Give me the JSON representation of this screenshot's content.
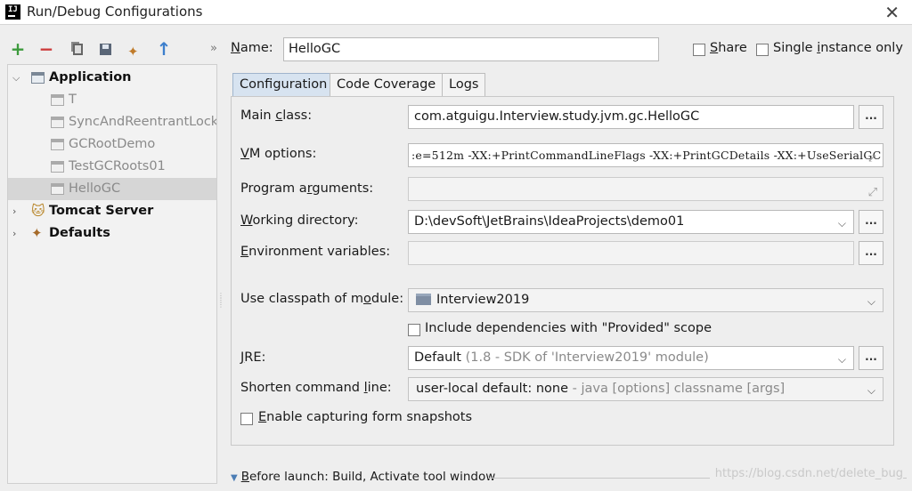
{
  "window": {
    "title": "Run/Debug Configurations",
    "app_icon": "intellij-icon",
    "close_icon": "close-icon"
  },
  "toolbar": {
    "icons": [
      "add-icon",
      "remove-icon",
      "copy-icon",
      "save-icon",
      "wrench-icon",
      "move-up-icon",
      "more-icon"
    ],
    "more_label": "»"
  },
  "tree": {
    "application": {
      "label": "Application",
      "children": [
        "T",
        "SyncAndReentrantLockD",
        "GCRootDemo",
        "TestGCRoots01",
        "HelloGC"
      ],
      "selected": "HelloGC"
    },
    "tomcat": {
      "label": "Tomcat Server"
    },
    "defaults": {
      "label": "Defaults"
    }
  },
  "header": {
    "name_label_prefix": "N",
    "name_label_rest": "ame:",
    "name_value": "HelloGC",
    "share_label_prefix": "S",
    "share_label_rest": "hare",
    "single_instance_prefix": "Single ",
    "single_instance_u": "i",
    "single_instance_rest": "nstance only"
  },
  "tabs": [
    {
      "label": "Configuration",
      "active": true
    },
    {
      "label": "Code Coverage",
      "active": false
    },
    {
      "label": "Logs",
      "active": false
    }
  ],
  "form": {
    "main_class": {
      "label_prefix": "Main ",
      "label_u": "c",
      "label_rest": "lass:",
      "value": "com.atguigu.Interview.study.jvm.gc.HelloGC"
    },
    "vm_options": {
      "label_prefix": "V",
      "label_rest": "M options:",
      "value": ":e=512m -XX:+PrintCommandLineFlags -XX:+PrintGCDetails -XX:+UseSerialGC"
    },
    "program_arguments": {
      "label_prefix": "Program a",
      "label_u": "r",
      "label_rest": "guments:",
      "value": ""
    },
    "working_directory": {
      "label_prefix": "W",
      "label_rest": "orking directory:",
      "value": "D:\\devSoft\\JetBrains\\IdeaProjects\\demo01"
    },
    "environment_variables": {
      "label_prefix": "E",
      "label_rest": "nvironment variables:",
      "value": ""
    },
    "classpath_module": {
      "label_prefix": "Use classpath of m",
      "label_u": "o",
      "label_rest": "dule:",
      "value": "Interview2019"
    },
    "include_provided": {
      "label": "Include dependencies with \"Provided\" scope",
      "checked": false
    },
    "jre": {
      "label_prefix": "J",
      "label_rest": "RE:",
      "value": "Default",
      "value_detail": " (1.8 - SDK of 'Interview2019' module)"
    },
    "shorten_command_line": {
      "label_prefix": "Shorten command ",
      "label_u": "l",
      "label_rest": "ine:",
      "value": "user-local default: none",
      "value_detail": " - java [options] classname [args]"
    },
    "capture_snapshots": {
      "label_prefix": "E",
      "label_rest": "nable capturing form snapshots",
      "checked": false
    }
  },
  "before_launch": {
    "label_prefix": "B",
    "label_rest": "efore launch: Build, Activate tool window"
  },
  "button_labels": {
    "dots": "...",
    "expand": "⤢",
    "dropdown": "⌵"
  },
  "watermark": "https://blog.csdn.net/delete_bug"
}
